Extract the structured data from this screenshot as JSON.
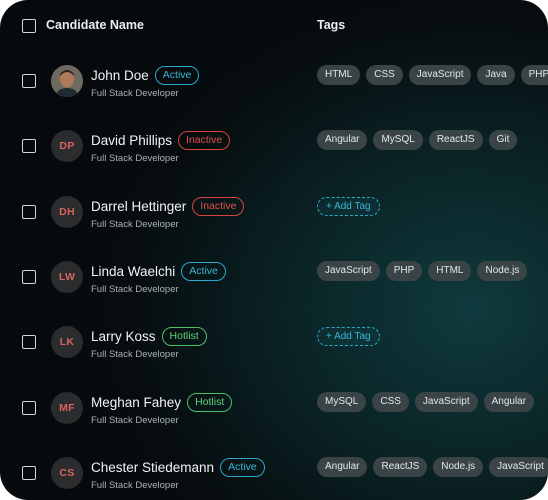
{
  "header": {
    "col_name": "Candidate Name",
    "col_tags": "Tags"
  },
  "add_tag_label": "+ Add Tag",
  "candidates": [
    {
      "name": "John Doe",
      "initials": "",
      "role": "Full Stack Developer",
      "status": "Active",
      "status_type": "active",
      "tags": [
        "HTML",
        "CSS",
        "JavaScript",
        "Java",
        "PHP"
      ]
    },
    {
      "name": "David Phillips",
      "initials": "DP",
      "role": "Full Stack Developer",
      "status": "Inactive",
      "status_type": "inactive",
      "tags": [
        "Angular",
        "MySQL",
        "ReactJS",
        "Git"
      ]
    },
    {
      "name": "Darrel Hettinger",
      "initials": "DH",
      "role": "Full Stack Developer",
      "status": "Inactive",
      "status_type": "inactive",
      "tags": []
    },
    {
      "name": "Linda Waelchi",
      "initials": "LW",
      "role": "Full Stack Developer",
      "status": "Active",
      "status_type": "active",
      "tags": [
        "JavaScript",
        "PHP",
        "HTML",
        "Node.js"
      ]
    },
    {
      "name": "Larry Koss",
      "initials": "LK",
      "role": "Full Stack Developer",
      "status": "Hotlist",
      "status_type": "hotlist",
      "tags": []
    },
    {
      "name": "Meghan Fahey",
      "initials": "MF",
      "role": "Full Stack Developer",
      "status": "Hotlist",
      "status_type": "hotlist",
      "tags": [
        "MySQL",
        "CSS",
        "JavaScript",
        "Angular"
      ]
    },
    {
      "name": "Chester Stiedemann",
      "initials": "CS",
      "role": "Full Stack Developer",
      "status": "Active",
      "status_type": "active",
      "tags": [
        "Angular",
        "ReactJS",
        "Node.js",
        "JavaScript"
      ]
    }
  ],
  "colors": {
    "active": "#39b6d6",
    "inactive": "#e0504b",
    "hotlist": "#5fd07a",
    "tag_bg": "#3a4446"
  }
}
